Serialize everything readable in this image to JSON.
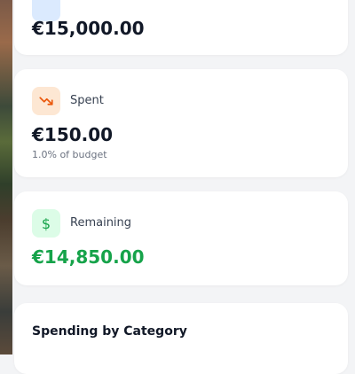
{
  "budget_card": {
    "amount": "€15,000.00"
  },
  "spent_card": {
    "label": "Spent",
    "amount": "€150.00",
    "subtext": "1.0% of budget",
    "accent_bg": "#fde7d3",
    "accent_fg": "#ea580c"
  },
  "remaining_card": {
    "label": "Remaining",
    "amount": "€14,850.00",
    "icon_glyph": "$",
    "accent_bg": "#dcfce7",
    "accent_fg": "#16a34a",
    "amount_color": "#16a34a"
  },
  "category_card": {
    "title": "Spending by Category"
  }
}
